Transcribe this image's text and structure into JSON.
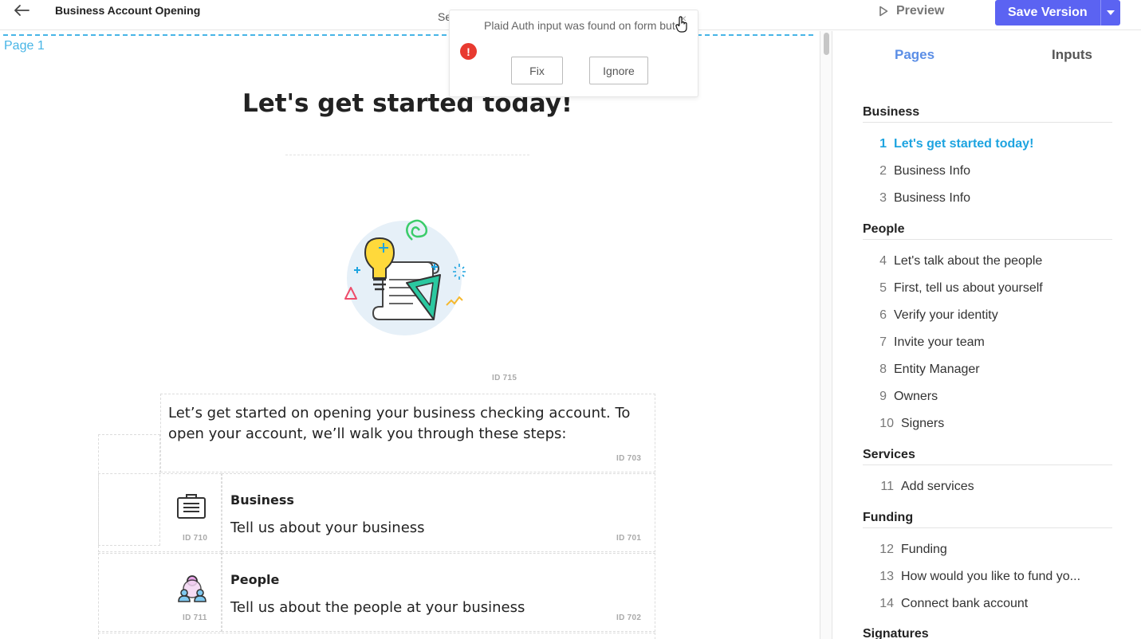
{
  "header": {
    "title": "Business Account Opening",
    "mid_label": "Se",
    "preview_label": "Preview",
    "save_label": "Save Version"
  },
  "canvas": {
    "page_label": "Page 1",
    "heading": "Let's get started today!",
    "illustration_id": "ID 715",
    "intro_text": "Let’s get started on opening your business checking account. To open your account, we’ll walk you through these steps:",
    "intro_id": "ID 703",
    "steps": [
      {
        "title": "Business",
        "desc": "Tell us about your business",
        "icon": "briefcase-icon",
        "icon_id": "ID 710",
        "text_id": "ID 701"
      },
      {
        "title": "People",
        "desc": "Tell us about the people at your business",
        "icon": "people-icon",
        "icon_id": "ID 711",
        "text_id": "ID 702"
      }
    ]
  },
  "popup": {
    "message": "Plaid Auth input was found on form but the app is not installed.",
    "fix_label": "Fix",
    "ignore_label": "Ignore",
    "icon": "error-icon",
    "error_mark": "!",
    "close_mark": "×"
  },
  "sidebar": {
    "tabs": [
      {
        "label": "Pages",
        "active": true
      },
      {
        "label": "Inputs",
        "active": false
      }
    ],
    "sections": [
      {
        "name": "Business",
        "items": [
          {
            "num": "1",
            "label": "Let's get started today!",
            "active": true
          },
          {
            "num": "2",
            "label": "Business Info"
          },
          {
            "num": "3",
            "label": "Business Info"
          }
        ]
      },
      {
        "name": "People",
        "items": [
          {
            "num": "4",
            "label": "Let's talk about the people"
          },
          {
            "num": "5",
            "label": "First, tell us about yourself"
          },
          {
            "num": "6",
            "label": "Verify your identity"
          },
          {
            "num": "7",
            "label": "Invite your team"
          },
          {
            "num": "8",
            "label": "Entity Manager"
          },
          {
            "num": "9",
            "label": "Owners"
          },
          {
            "num": "10",
            "label": "Signers"
          }
        ]
      },
      {
        "name": "Services",
        "items": [
          {
            "num": "11",
            "label": "Add services"
          }
        ]
      },
      {
        "name": "Funding",
        "items": [
          {
            "num": "12",
            "label": "Funding"
          },
          {
            "num": "13",
            "label": "How would you like to fund yo..."
          },
          {
            "num": "14",
            "label": "Connect bank account"
          }
        ]
      },
      {
        "name": "Signatures",
        "items": []
      }
    ]
  },
  "colors": {
    "accent": "#5b63f2",
    "page_blue": "#47b5e6",
    "active_item": "#1ea4e0",
    "error": "#e83a30"
  }
}
